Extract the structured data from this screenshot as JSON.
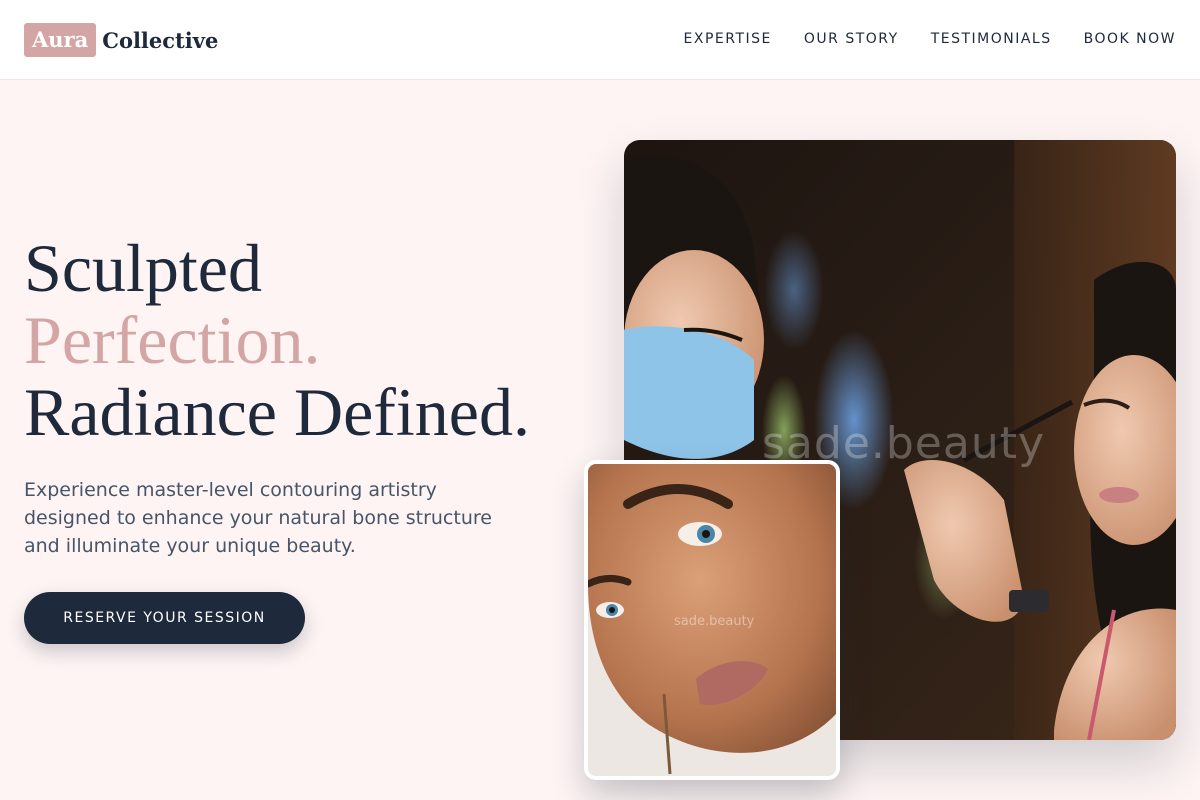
{
  "brand": {
    "badge": "Aura",
    "name": "Collective"
  },
  "nav": [
    {
      "label": "EXPERTISE"
    },
    {
      "label": "OUR STORY"
    },
    {
      "label": "TESTIMONIALS"
    },
    {
      "label": "BOOK NOW"
    }
  ],
  "hero": {
    "line1": "Sculpted",
    "line2": "Perfection.",
    "line3": "Radiance Defined.",
    "description": "Experience master-level contouring artistry designed to enhance your natural bone structure and illuminate your unique beauty.",
    "cta_label": "RESERVE YOUR SESSION"
  },
  "images": {
    "main_watermark": "sade.beauty",
    "inset_watermark": "sade.beauty"
  },
  "colors": {
    "accent": "#d4a5a5",
    "dark": "#1e293b",
    "background": "#fdf4f3"
  }
}
